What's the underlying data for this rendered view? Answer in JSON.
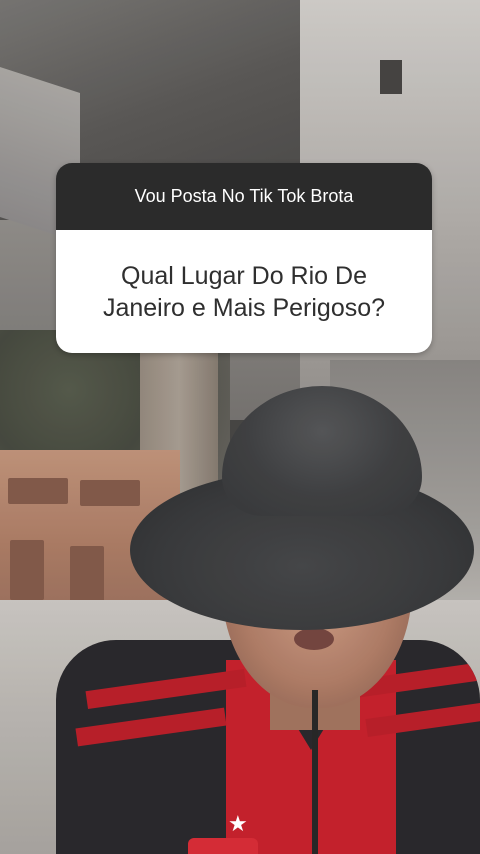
{
  "question_sticker": {
    "header": "Vou Posta No Tik Tok Brota",
    "question": "Qual Lugar Do Rio De Janeiro e Mais Perigoso?"
  },
  "colors": {
    "sticker_header_bg": "#2b2b2b",
    "sticker_body_bg": "#ffffff",
    "shirt_red": "#c0141f",
    "shirt_black": "#1c1b1f"
  },
  "icons": {
    "crest": "star-icon"
  }
}
